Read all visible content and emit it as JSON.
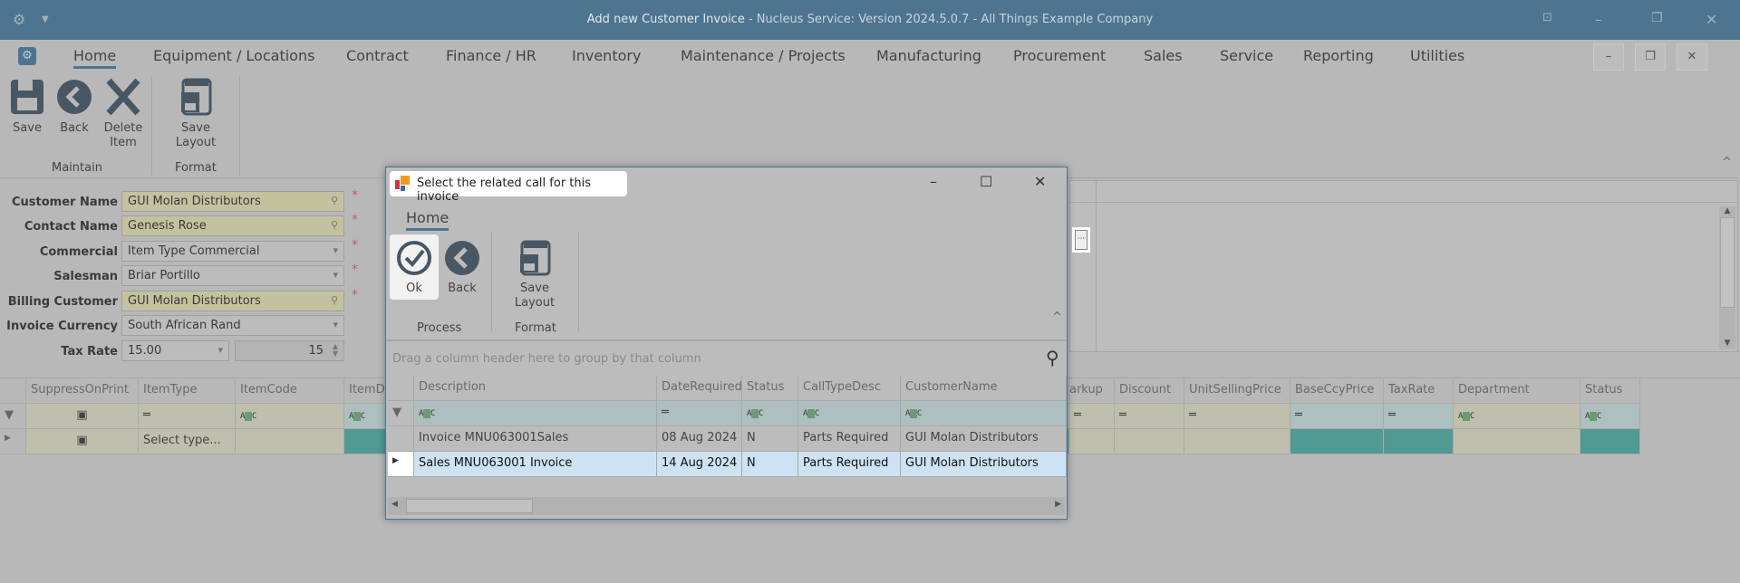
{
  "window": {
    "title_main": "Add new Customer Invoice",
    "title_rest": " - Nucleus Service: Version 2024.5.0.7 - All Things Example Company"
  },
  "menu": {
    "tabs": [
      "Home",
      "Equipment / Locations",
      "Contract",
      "Finance / HR",
      "Inventory",
      "Maintenance / Projects",
      "Manufacturing",
      "Procurement",
      "Sales",
      "Service",
      "Reporting",
      "Utilities"
    ]
  },
  "ribbon": {
    "save": "Save",
    "back": "Back",
    "delete_1": "Delete",
    "delete_2": "Item",
    "save_layout": "Save Layout",
    "group_maintain": "Maintain",
    "group_format": "Format"
  },
  "form": {
    "customer_name_label": "Customer Name",
    "customer_name": "GUI Molan Distributors",
    "contact_name_label": "Contact Name",
    "contact_name": "Genesis Rose",
    "commercial_label": "Commercial",
    "commercial": "Item Type Commercial",
    "salesman_label": "Salesman",
    "salesman": "Briar Portillo",
    "billing_customer_label": "Billing Customer",
    "billing_customer": "GUI Molan Distributors",
    "invoice_currency_label": "Invoice Currency",
    "invoice_currency": "South African Rand",
    "tax_rate_label": "Tax Rate",
    "tax_rate": "15.00",
    "tax_rate_spin": "15",
    "required": "*"
  },
  "lines_grid": {
    "columns": [
      "SuppressOnPrint",
      "ItemType",
      "ItemCode",
      "ItemDe",
      "arkup",
      "Discount",
      "UnitSellingPrice",
      "BaseCcyPrice",
      "TaxRate",
      "Department",
      "Status"
    ],
    "row_itemtype": "Select type..."
  },
  "dialog": {
    "title": "Select the related call for this invoice",
    "tab": "Home",
    "ok": "Ok",
    "back": "Back",
    "save_layout": "Save Layout",
    "group_process": "Process",
    "group_format": "Format",
    "group_panel": "Drag a column header here to group by that column",
    "columns": [
      "Description",
      "DateRequired",
      "Status",
      "CallTypeDesc",
      "CustomerName"
    ],
    "rows": [
      {
        "description": "Invoice MNU063001Sales",
        "date": "08 Aug 2024",
        "status": "N",
        "calltype": "Parts Required",
        "customer": "GUI Molan Distributors"
      },
      {
        "description": "Sales MNU063001 Invoice",
        "date": "14 Aug 2024",
        "status": "N",
        "calltype": "Parts Required",
        "customer": "GUI Molan Distributors"
      }
    ]
  },
  "colors": {
    "titlebar": "#4e758f",
    "selected_row": "#cde3f3",
    "teal": "#519a94",
    "lookup_field": "#c3c29f"
  }
}
